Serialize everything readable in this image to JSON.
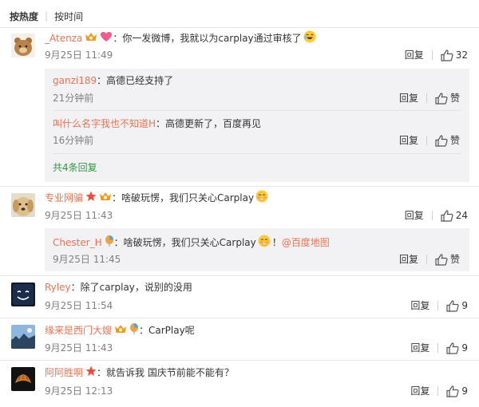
{
  "sort": {
    "hot": "按热度",
    "time": "按时间"
  },
  "colors": {
    "username": "#eb7350",
    "link": "#2f9b3a",
    "meta": "#808080",
    "bg_reply": "#f2f2f5"
  },
  "reply_label": "回复",
  "like_label": "赞",
  "comments": [
    {
      "user": "_Atenza",
      "text": "：你一发微博，我就以为carplay通过审核了",
      "time": "9月25日 11:49",
      "likes": "32",
      "replies": [
        {
          "user": "ganzi189",
          "text": "：高德已经支持了",
          "time": "21分钟前",
          "likes": "赞"
        },
        {
          "user": "叫什么名字我也不知道H",
          "text": "：高德更新了，百度再见",
          "time": "16分钟前",
          "likes": "赞"
        }
      ],
      "more": "共4条回复"
    },
    {
      "user": "专业网骗",
      "text": "：啥破玩愣，我们只关心Carplay",
      "time": "9月25日 11:43",
      "likes": "24",
      "replies": [
        {
          "user": "Chester_H",
          "text": "：啥破玩愣，我们只关心Carplay",
          "mention": "@百度地图",
          "time": "9月25日 11:45",
          "likes": "赞"
        }
      ]
    },
    {
      "user": "Ryley",
      "text": "：除了carplay，说别的没用",
      "time": "9月25日 11:54",
      "likes": "9"
    },
    {
      "user": "缘来是西门大嫂",
      "text": "：CarPlay呢",
      "time": "9月25日 11:43",
      "likes": "9"
    },
    {
      "user": "阿阿胜啊",
      "text": "：就告诉我 国庆节前能不能有？",
      "time": "9月25日 12:13",
      "likes": "9"
    }
  ]
}
